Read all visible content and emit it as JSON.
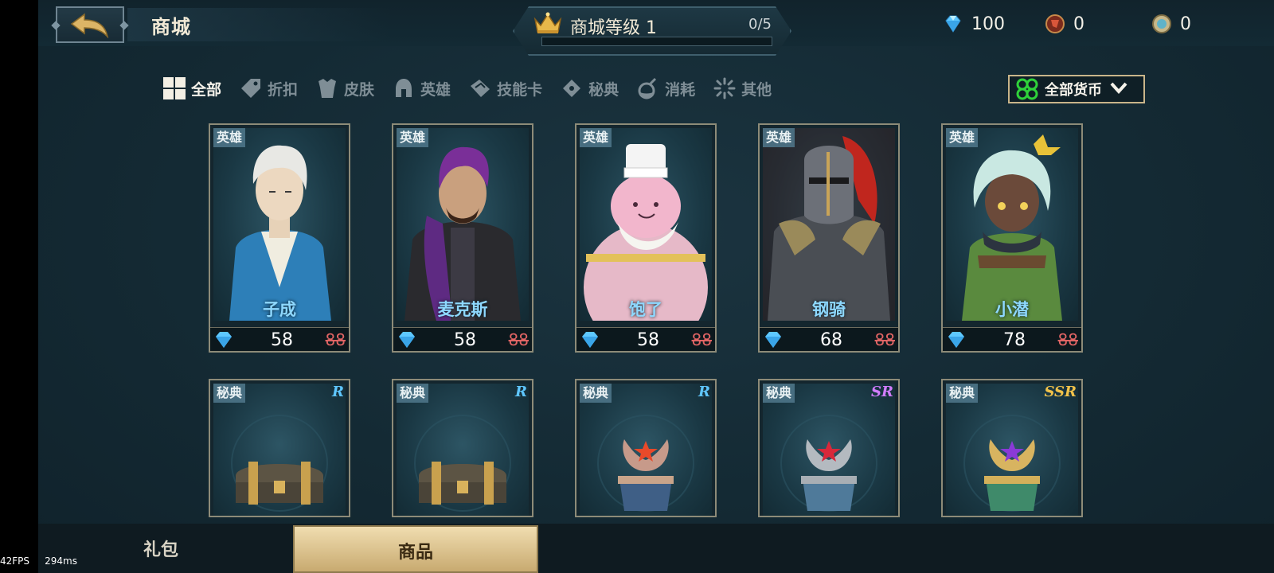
{
  "header": {
    "title": "商城",
    "back_icon": "back-arrow-icon",
    "shop_level_label": "商城等级 1",
    "shop_level_progress": "0/5",
    "shop_level_fraction": 0.0
  },
  "currencies": [
    {
      "icon": "diamond-icon",
      "value": "100"
    },
    {
      "icon": "red-token-icon",
      "value": "0"
    },
    {
      "icon": "coin-token-icon",
      "value": "0"
    }
  ],
  "filters": [
    {
      "label": "全部",
      "icon": "grid-icon",
      "active": true
    },
    {
      "label": "折扣",
      "icon": "price-tag-icon",
      "active": false
    },
    {
      "label": "皮肤",
      "icon": "armor-icon",
      "active": false
    },
    {
      "label": "英雄",
      "icon": "helmet-icon",
      "active": false
    },
    {
      "label": "技能卡",
      "icon": "card-icon",
      "active": false
    },
    {
      "label": "秘典",
      "icon": "tome-icon",
      "active": false
    },
    {
      "label": "消耗",
      "icon": "potion-icon",
      "active": false
    },
    {
      "label": "其他",
      "icon": "burst-icon",
      "active": false
    }
  ],
  "currency_filter": {
    "label": "全部货币",
    "icon": "clover-icon"
  },
  "heroes": [
    {
      "tag": "英雄",
      "name": "子成",
      "price": "58",
      "old_price": "88",
      "portrait": "white-haired-swordsman"
    },
    {
      "tag": "英雄",
      "name": "麦克斯",
      "price": "58",
      "old_price": "88",
      "portrait": "purple-haired-brawler"
    },
    {
      "tag": "英雄",
      "name": "饱了",
      "price": "58",
      "old_price": "88",
      "portrait": "pink-chef"
    },
    {
      "tag": "英雄",
      "name": "钢骑",
      "price": "68",
      "old_price": "88",
      "portrait": "armored-knight"
    },
    {
      "tag": "英雄",
      "name": "小潜",
      "price": "78",
      "old_price": "88",
      "portrait": "green-haired-rogue"
    }
  ],
  "tomes": [
    {
      "tag": "秘典",
      "rarity": "R",
      "rarity_color": "#5fc6ff",
      "item": "wooden-chest"
    },
    {
      "tag": "秘典",
      "rarity": "R",
      "rarity_color": "#5fc6ff",
      "item": "wooden-chest"
    },
    {
      "tag": "秘典",
      "rarity": "R",
      "rarity_color": "#5fc6ff",
      "item": "laurel-chest-bronze"
    },
    {
      "tag": "秘典",
      "rarity": "SR",
      "rarity_color": "#d27cff",
      "item": "laurel-chest-silver"
    },
    {
      "tag": "秘典",
      "rarity": "SSR",
      "rarity_color": "#f1c24a",
      "item": "laurel-chest-gold"
    }
  ],
  "bottom_tabs": [
    {
      "label": "礼包",
      "active": false
    },
    {
      "label": "商品",
      "active": true
    }
  ],
  "debug": {
    "fps": "42FPS",
    "latency": "294ms"
  }
}
